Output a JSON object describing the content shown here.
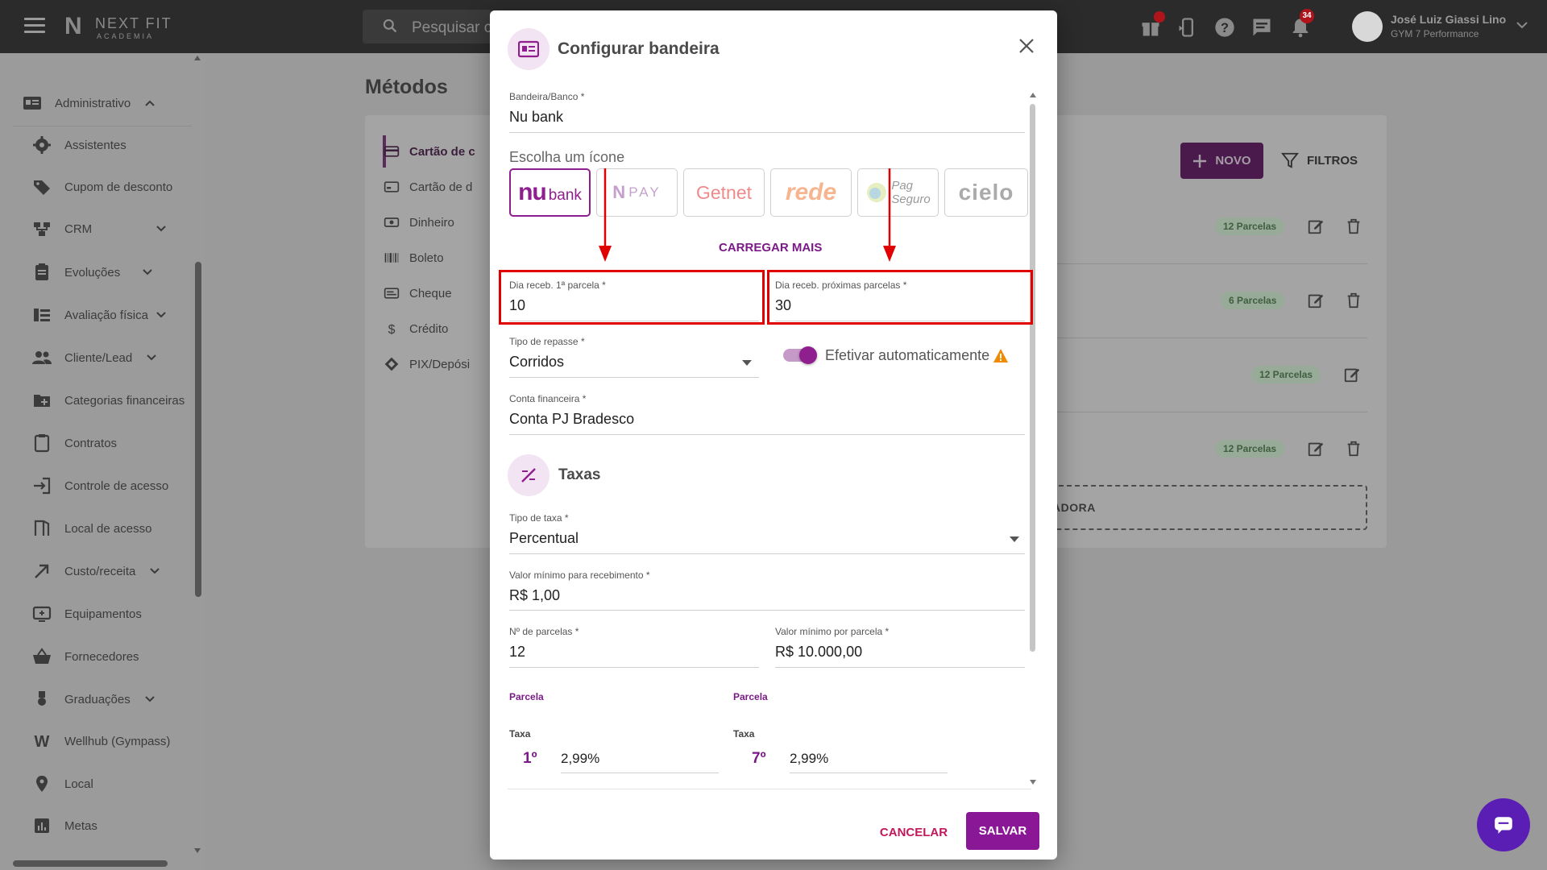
{
  "app": {
    "logo_name": "NEXT FIT",
    "logo_sub": "ACADEMIA",
    "search_placeholder": "Pesquisar ci",
    "gift_badge": "",
    "notifications_count": "34",
    "user_name": "José Luiz Giassi Lino",
    "user_company": "GYM 7 Performance"
  },
  "sidebar": {
    "items": [
      {
        "label": "Administrativo",
        "icon": "admin-card-icon"
      },
      {
        "label": "Assistentes",
        "icon": "gear-icon"
      },
      {
        "label": "Cupom de desconto",
        "icon": "tag-icon"
      },
      {
        "label": "CRM",
        "icon": "crm-icon"
      },
      {
        "label": "Evoluções",
        "icon": "clipboard-icon"
      },
      {
        "label": "Avaliação física",
        "icon": "list-icon"
      },
      {
        "label": "Cliente/Lead",
        "icon": "people-icon"
      },
      {
        "label": "Categorias financeiras",
        "icon": "folder-plus-icon"
      },
      {
        "label": "Contratos",
        "icon": "clipboard-icon"
      },
      {
        "label": "Controle de acesso",
        "icon": "login-icon"
      },
      {
        "label": "Local de acesso",
        "icon": "door-icon"
      },
      {
        "label": "Custo/receita",
        "icon": "arrow-up-right-icon"
      },
      {
        "label": "Equipamentos",
        "icon": "equipment-icon"
      },
      {
        "label": "Fornecedores",
        "icon": "basket-icon"
      },
      {
        "label": "Graduações",
        "icon": "medal-icon"
      },
      {
        "label": "Wellhub (Gympass)",
        "icon": "w-icon"
      },
      {
        "label": "Local",
        "icon": "pin-icon"
      },
      {
        "label": "Metas",
        "icon": "bar-chart-icon"
      }
    ]
  },
  "page": {
    "title": "Métodos",
    "methods": [
      "Cartão de c",
      "Cartão de d",
      "Dinheiro",
      "Boleto",
      "Cheque",
      "Crédito",
      "PIX/Depósi"
    ],
    "novo_label": "NOVO",
    "filtros_label": "FILTROS",
    "parcelas": [
      "12 Parcelas",
      "6 Parcelas",
      "12 Parcelas",
      "12 Parcelas"
    ],
    "add_text": "ADORA"
  },
  "modal": {
    "title": "Configurar bandeira",
    "bandeira_label": "Bandeira/Banco *",
    "bandeira_value": "Nu bank",
    "choose_icon_label": "Escolha um ícone",
    "icons": [
      "bank",
      "PAY",
      "Getnet",
      "rede",
      "Pag",
      "Seguro",
      "cielo"
    ],
    "load_more": "CARREGAR MAIS",
    "dia_primeira_label": "Dia receb. 1ª parcela *",
    "dia_primeira_value": "10",
    "dia_proximas_label": "Dia receb. próximas parcelas *",
    "dia_proximas_value": "30",
    "tipo_repasse_label": "Tipo de repasse *",
    "tipo_repasse_value": "Corridos",
    "efetivar_label": "Efetivar automaticamente",
    "conta_label": "Conta financeira *",
    "conta_value": "Conta PJ Bradesco",
    "taxas_title": "Taxas",
    "tipo_taxa_label": "Tipo de taxa *",
    "tipo_taxa_value": "Percentual",
    "valor_minimo_label": "Valor mínimo para recebimento *",
    "valor_minimo_value": "R$ 1,00",
    "num_parcelas_label": "Nº de parcelas *",
    "num_parcelas_value": "12",
    "valor_min_parcela_label": "Valor mínimo por parcela *",
    "valor_min_parcela_value": "R$ 10.000,00",
    "parcela_head": "Parcela",
    "taxa_head": "Taxa",
    "col1_num": "1º",
    "col1_taxa": "2,99%",
    "col2_num": "7º",
    "col2_taxa": "2,99%",
    "cancel_label": "CANCELAR",
    "save_label": "SALVAR"
  },
  "colors": {
    "accent": "#8a1896",
    "highlight": "#e10000",
    "topbar": "#2b2b2b"
  }
}
